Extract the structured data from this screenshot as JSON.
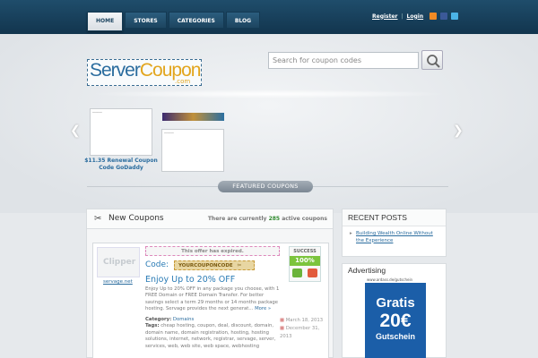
{
  "nav": {
    "items": [
      "HOME",
      "STORES",
      "CATEGORIES",
      "BLOG"
    ],
    "active": 0
  },
  "toplinks": {
    "register": "Register",
    "login": "Login",
    "separator": "|"
  },
  "colors": {
    "header": "#1a4360",
    "accent": "#2a6c9e",
    "logo_accent": "#e2a51d",
    "success": "#7cc43d"
  },
  "logo": {
    "part1": "Server",
    "part2": "Coupon",
    "suffix": ".com"
  },
  "search": {
    "placeholder": "Search for coupon codes"
  },
  "carousel": {
    "slide1_caption": "$11.35 Renewal Coupon Code GoDaddy"
  },
  "featured": {
    "label": "FEATURED COUPONS"
  },
  "main": {
    "title": "New Coupons",
    "count_prefix": "There are currently",
    "count": "285",
    "count_suffix": "active coupons"
  },
  "coupon": {
    "store_logo_text": "Clipper",
    "store_link": "servage.net",
    "expired_notice": "This offer has expired.",
    "code_label": "Code:",
    "code": "YOURCOUPONCODE",
    "title": "Enjoy Up to 20% OFF",
    "description": "Enjoy Up to 20% OFF in any package you choose, with 1 FREE Domain or FREE Domain Transfer. For better savings select a term 29 months or 14 months package hosting. Servage provides the next generat...",
    "more": "More »",
    "category_label": "Category:",
    "category": "Domains",
    "tags_label": "Tags:",
    "tags": "cheap hosting, coupon, deal, discount, domain, domain name, domain registration, hosting, hosting solutions, internet, network, registrar, servage, server, services, web, web site, web space, webhosting",
    "date_start": "March 18, 2013",
    "date_end": "December 31, 2013",
    "success_label": "SUCCESS",
    "success_pct": "100%"
  },
  "sidebar": {
    "recent_title": "RECENT POSTS",
    "recent_posts": [
      "Building Wealth Online Without the Experience"
    ],
    "advertising_title": "Advertising",
    "ad": {
      "url": "www.ardass.de/gutschein",
      "line1": "Gratis",
      "line2": "20€",
      "line3": "Gutschein"
    }
  }
}
